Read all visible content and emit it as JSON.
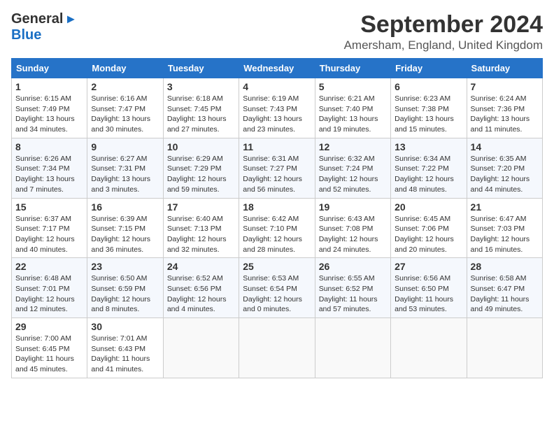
{
  "header": {
    "logo": {
      "general": "General",
      "blue": "Blue",
      "icon": "▶"
    },
    "title": "September 2024",
    "subtitle": "Amersham, England, United Kingdom"
  },
  "calendar": {
    "weekdays": [
      "Sunday",
      "Monday",
      "Tuesday",
      "Wednesday",
      "Thursday",
      "Friday",
      "Saturday"
    ],
    "weeks": [
      [
        {
          "day": "",
          "sunrise": "",
          "sunset": "",
          "daylight": "",
          "empty": true
        },
        {
          "day": "2",
          "sunrise": "Sunrise: 6:16 AM",
          "sunset": "Sunset: 7:47 PM",
          "daylight": "Daylight: 13 hours and 30 minutes."
        },
        {
          "day": "3",
          "sunrise": "Sunrise: 6:18 AM",
          "sunset": "Sunset: 7:45 PM",
          "daylight": "Daylight: 13 hours and 27 minutes."
        },
        {
          "day": "4",
          "sunrise": "Sunrise: 6:19 AM",
          "sunset": "Sunset: 7:43 PM",
          "daylight": "Daylight: 13 hours and 23 minutes."
        },
        {
          "day": "5",
          "sunrise": "Sunrise: 6:21 AM",
          "sunset": "Sunset: 7:40 PM",
          "daylight": "Daylight: 13 hours and 19 minutes."
        },
        {
          "day": "6",
          "sunrise": "Sunrise: 6:23 AM",
          "sunset": "Sunset: 7:38 PM",
          "daylight": "Daylight: 13 hours and 15 minutes."
        },
        {
          "day": "7",
          "sunrise": "Sunrise: 6:24 AM",
          "sunset": "Sunset: 7:36 PM",
          "daylight": "Daylight: 13 hours and 11 minutes."
        }
      ],
      [
        {
          "day": "8",
          "sunrise": "Sunrise: 6:26 AM",
          "sunset": "Sunset: 7:34 PM",
          "daylight": "Daylight: 13 hours and 7 minutes."
        },
        {
          "day": "9",
          "sunrise": "Sunrise: 6:27 AM",
          "sunset": "Sunset: 7:31 PM",
          "daylight": "Daylight: 13 hours and 3 minutes."
        },
        {
          "day": "10",
          "sunrise": "Sunrise: 6:29 AM",
          "sunset": "Sunset: 7:29 PM",
          "daylight": "Daylight: 12 hours and 59 minutes."
        },
        {
          "day": "11",
          "sunrise": "Sunrise: 6:31 AM",
          "sunset": "Sunset: 7:27 PM",
          "daylight": "Daylight: 12 hours and 56 minutes."
        },
        {
          "day": "12",
          "sunrise": "Sunrise: 6:32 AM",
          "sunset": "Sunset: 7:24 PM",
          "daylight": "Daylight: 12 hours and 52 minutes."
        },
        {
          "day": "13",
          "sunrise": "Sunrise: 6:34 AM",
          "sunset": "Sunset: 7:22 PM",
          "daylight": "Daylight: 12 hours and 48 minutes."
        },
        {
          "day": "14",
          "sunrise": "Sunrise: 6:35 AM",
          "sunset": "Sunset: 7:20 PM",
          "daylight": "Daylight: 12 hours and 44 minutes."
        }
      ],
      [
        {
          "day": "15",
          "sunrise": "Sunrise: 6:37 AM",
          "sunset": "Sunset: 7:17 PM",
          "daylight": "Daylight: 12 hours and 40 minutes."
        },
        {
          "day": "16",
          "sunrise": "Sunrise: 6:39 AM",
          "sunset": "Sunset: 7:15 PM",
          "daylight": "Daylight: 12 hours and 36 minutes."
        },
        {
          "day": "17",
          "sunrise": "Sunrise: 6:40 AM",
          "sunset": "Sunset: 7:13 PM",
          "daylight": "Daylight: 12 hours and 32 minutes."
        },
        {
          "day": "18",
          "sunrise": "Sunrise: 6:42 AM",
          "sunset": "Sunset: 7:10 PM",
          "daylight": "Daylight: 12 hours and 28 minutes."
        },
        {
          "day": "19",
          "sunrise": "Sunrise: 6:43 AM",
          "sunset": "Sunset: 7:08 PM",
          "daylight": "Daylight: 12 hours and 24 minutes."
        },
        {
          "day": "20",
          "sunrise": "Sunrise: 6:45 AM",
          "sunset": "Sunset: 7:06 PM",
          "daylight": "Daylight: 12 hours and 20 minutes."
        },
        {
          "day": "21",
          "sunrise": "Sunrise: 6:47 AM",
          "sunset": "Sunset: 7:03 PM",
          "daylight": "Daylight: 12 hours and 16 minutes."
        }
      ],
      [
        {
          "day": "22",
          "sunrise": "Sunrise: 6:48 AM",
          "sunset": "Sunset: 7:01 PM",
          "daylight": "Daylight: 12 hours and 12 minutes."
        },
        {
          "day": "23",
          "sunrise": "Sunrise: 6:50 AM",
          "sunset": "Sunset: 6:59 PM",
          "daylight": "Daylight: 12 hours and 8 minutes."
        },
        {
          "day": "24",
          "sunrise": "Sunrise: 6:52 AM",
          "sunset": "Sunset: 6:56 PM",
          "daylight": "Daylight: 12 hours and 4 minutes."
        },
        {
          "day": "25",
          "sunrise": "Sunrise: 6:53 AM",
          "sunset": "Sunset: 6:54 PM",
          "daylight": "Daylight: 12 hours and 0 minutes."
        },
        {
          "day": "26",
          "sunrise": "Sunrise: 6:55 AM",
          "sunset": "Sunset: 6:52 PM",
          "daylight": "Daylight: 11 hours and 57 minutes."
        },
        {
          "day": "27",
          "sunrise": "Sunrise: 6:56 AM",
          "sunset": "Sunset: 6:50 PM",
          "daylight": "Daylight: 11 hours and 53 minutes."
        },
        {
          "day": "28",
          "sunrise": "Sunrise: 6:58 AM",
          "sunset": "Sunset: 6:47 PM",
          "daylight": "Daylight: 11 hours and 49 minutes."
        }
      ],
      [
        {
          "day": "29",
          "sunrise": "Sunrise: 7:00 AM",
          "sunset": "Sunset: 6:45 PM",
          "daylight": "Daylight: 11 hours and 45 minutes."
        },
        {
          "day": "30",
          "sunrise": "Sunrise: 7:01 AM",
          "sunset": "Sunset: 6:43 PM",
          "daylight": "Daylight: 11 hours and 41 minutes."
        },
        {
          "day": "",
          "sunrise": "",
          "sunset": "",
          "daylight": "",
          "empty": true
        },
        {
          "day": "",
          "sunrise": "",
          "sunset": "",
          "daylight": "",
          "empty": true
        },
        {
          "day": "",
          "sunrise": "",
          "sunset": "",
          "daylight": "",
          "empty": true
        },
        {
          "day": "",
          "sunrise": "",
          "sunset": "",
          "daylight": "",
          "empty": true
        },
        {
          "day": "",
          "sunrise": "",
          "sunset": "",
          "daylight": "",
          "empty": true
        }
      ]
    ],
    "week0_day1": {
      "day": "1",
      "sunrise": "Sunrise: 6:15 AM",
      "sunset": "Sunset: 7:49 PM",
      "daylight": "Daylight: 13 hours and 34 minutes."
    }
  }
}
